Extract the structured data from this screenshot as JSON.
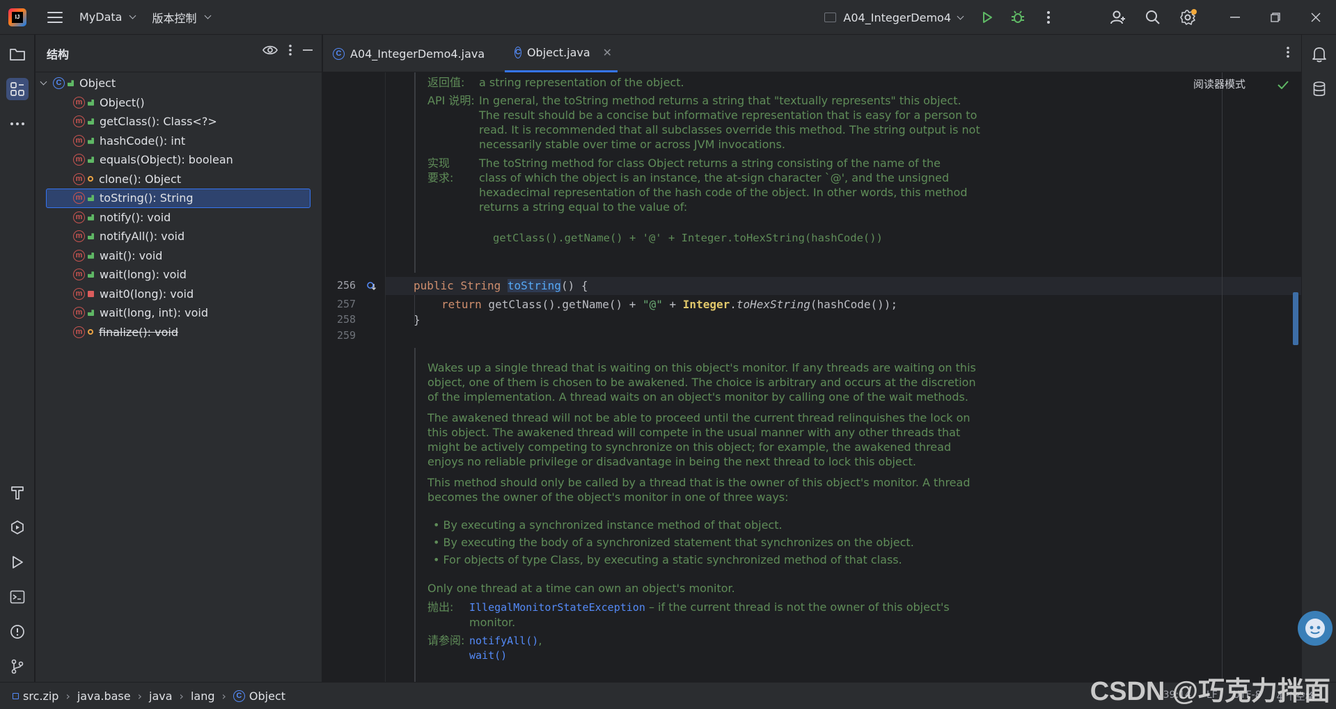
{
  "titlebar": {
    "project": "MyData",
    "vcs": "版本控制",
    "run_config": "A04_IntegerDemo4"
  },
  "structure": {
    "title": "结构",
    "root": "Object",
    "items": [
      {
        "label": "Object()",
        "vis": "pub"
      },
      {
        "label": "getClass(): Class<?>",
        "vis": "pub"
      },
      {
        "label": "hashCode(): int",
        "vis": "pub"
      },
      {
        "label": "equals(Object): boolean",
        "vis": "pub"
      },
      {
        "label": "clone(): Object",
        "vis": "prot"
      },
      {
        "label": "toString(): String",
        "vis": "pub",
        "selected": true
      },
      {
        "label": "notify(): void",
        "vis": "pub"
      },
      {
        "label": "notifyAll(): void",
        "vis": "pub"
      },
      {
        "label": "wait(): void",
        "vis": "pub"
      },
      {
        "label": "wait(long): void",
        "vis": "pub"
      },
      {
        "label": "wait0(long): void",
        "vis": "priv"
      },
      {
        "label": "wait(long, int): void",
        "vis": "pub"
      },
      {
        "label": "finalize(): void",
        "vis": "prot",
        "deprecated": true
      }
    ]
  },
  "tabs": [
    {
      "label": "A04_IntegerDemo4.java"
    },
    {
      "label": "Object.java",
      "active": true
    }
  ],
  "editor": {
    "reader_mode": "阅读器模式",
    "doc1": {
      "returns_label": "返回值:",
      "returns_text": "a string representation of the object.",
      "api_label": "API 说明:",
      "api_lines": [
        "In general, the toString method returns a string that \"textually represents\" this object.",
        "The result should be a concise but informative representation that is easy for a person to",
        "read. It is recommended that all subclasses override this method. The string output is not",
        "necessarily stable over time or across JVM invocations."
      ],
      "impl_label_1": "实现",
      "impl_label_2": "要求:",
      "impl_lines": [
        "The toString method for class Object returns a string consisting of the name of the",
        "class of which the object is an instance, the at-sign character `@', and the unsigned",
        "hexadecimal representation of the hash code of the object. In other words, this method",
        "returns a string equal to the value of:"
      ],
      "impl_code": "getClass().getName() + '@' + Integer.toHexString(hashCode())"
    },
    "line_numbers": [
      "256",
      "257",
      "258",
      "259"
    ],
    "code": {
      "l256_kw": "public",
      "l256_type": "String",
      "l256_name": "toString",
      "l256_rest": "() {",
      "l257_kw": "return",
      "l257_a": " getClass().getName() + ",
      "l257_str": "\"@\"",
      "l257_b": " + ",
      "l257_cls": "Integer",
      "l257_dot": ".",
      "l257_m": "toHexString",
      "l257_c": "(hashCode());",
      "l258": "}"
    },
    "doc2": {
      "p1": [
        "Wakes up a single thread that is waiting on this object's monitor. If any threads are waiting on this",
        "object, one of them is chosen to be awakened. The choice is arbitrary and occurs at the discretion",
        "of the implementation. A thread waits on an object's monitor by calling one of the wait methods."
      ],
      "p2": [
        "The awakened thread will not be able to proceed until the current thread relinquishes the lock on",
        "this object. The awakened thread will compete in the usual manner with any other threads that",
        "might be actively competing to synchronize on this object; for example, the awakened thread",
        "enjoys no reliable privilege or disadvantage in being the next thread to lock this object."
      ],
      "p3": [
        "This method should only be called by a thread that is the owner of this object's monitor. A thread",
        "becomes the owner of the object's monitor in one of three ways:"
      ],
      "bullets": [
        "By executing a synchronized instance method of that object.",
        "By executing the body of a synchronized statement that synchronizes on the object.",
        "For objects of type Class, by executing a static synchronized method of that class."
      ],
      "p4": "Only one thread at a time can own an object's monitor.",
      "throws_label": "抛出:",
      "throws_link": "IllegalMonitorStateException",
      "throws_text_1": " – if the current thread is not the owner of this object's",
      "throws_text_2": "monitor.",
      "see_label": "请参阅:",
      "see_link_1": "notifyAll()",
      "see_sep": ",",
      "see_link_2": "wait()"
    }
  },
  "statusbar": {
    "crumbs": [
      "src.zip",
      "java.base",
      "java",
      "lang",
      "Object"
    ],
    "position": "39:14",
    "line_sep": "LF",
    "encoding": "UTF-8",
    "indent": "4 个空格"
  },
  "watermark": "CSDN @巧克力拌面",
  "colors": {
    "accent": "#3574f0",
    "doc_green": "#5f8c58",
    "keyword": "#cf8e6d"
  }
}
